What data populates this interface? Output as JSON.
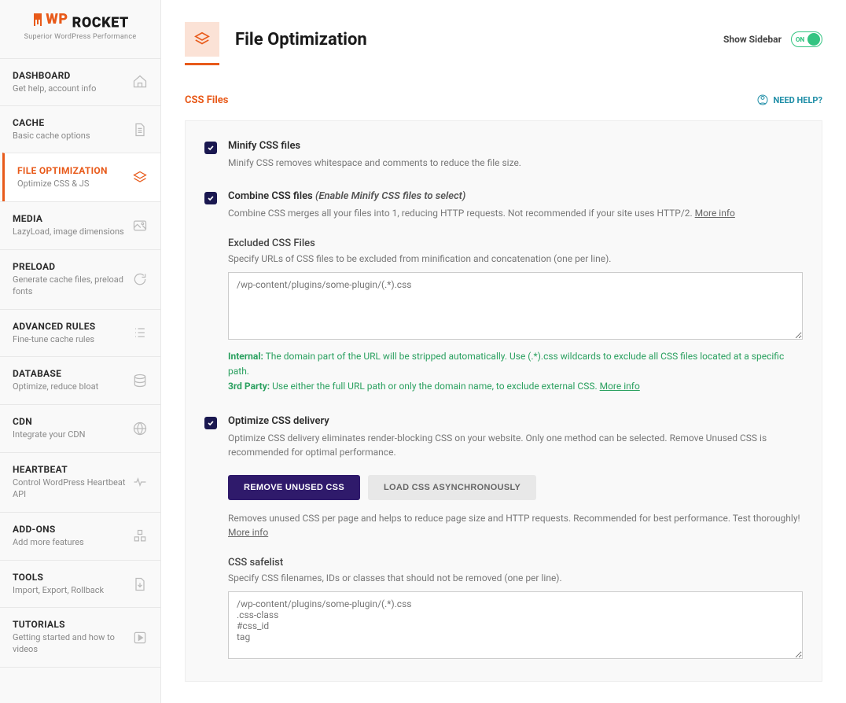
{
  "brand": {
    "name": "WP ROCKET",
    "tagline": "Superior WordPress Performance"
  },
  "nav": [
    {
      "title": "DASHBOARD",
      "sub": "Get help, account info"
    },
    {
      "title": "CACHE",
      "sub": "Basic cache options"
    },
    {
      "title": "FILE OPTIMIZATION",
      "sub": "Optimize CSS & JS"
    },
    {
      "title": "MEDIA",
      "sub": "LazyLoad, image dimensions"
    },
    {
      "title": "PRELOAD",
      "sub": "Generate cache files, preload fonts"
    },
    {
      "title": "ADVANCED RULES",
      "sub": "Fine-tune cache rules"
    },
    {
      "title": "DATABASE",
      "sub": "Optimize, reduce bloat"
    },
    {
      "title": "CDN",
      "sub": "Integrate your CDN"
    },
    {
      "title": "HEARTBEAT",
      "sub": "Control WordPress Heartbeat API"
    },
    {
      "title": "ADD-ONS",
      "sub": "Add more features"
    },
    {
      "title": "TOOLS",
      "sub": "Import, Export, Rollback"
    },
    {
      "title": "TUTORIALS",
      "sub": "Getting started and how to videos"
    }
  ],
  "header": {
    "title": "File Optimization",
    "show_sidebar": "Show Sidebar",
    "toggle_text": "ON"
  },
  "section": {
    "title": "CSS Files",
    "need_help": "NEED HELP?"
  },
  "options": {
    "minify": {
      "title": "Minify CSS files",
      "desc": "Minify CSS removes whitespace and comments to reduce the file size."
    },
    "combine": {
      "title": "Combine CSS files",
      "hint": "(Enable Minify CSS files to select)",
      "desc": "Combine CSS merges all your files into 1, reducing HTTP requests. Not recommended if your site uses HTTP/2.",
      "more": "More info",
      "excluded_label": "Excluded CSS Files",
      "excluded_desc": "Specify URLs of CSS files to be excluded from minification and concatenation (one per line).",
      "excluded_placeholder": "/wp-content/plugins/some-plugin/(.*).css",
      "helper_internal_label": "Internal:",
      "helper_internal": " The domain part of the URL will be stripped automatically. Use (.*).css wildcards to exclude all CSS files located at a specific path.",
      "helper_3rd_label": "3rd Party:",
      "helper_3rd": " Use either the full URL path or only the domain name, to exclude external CSS.",
      "helper_more": "More info"
    },
    "optimize": {
      "title": "Optimize CSS delivery",
      "desc": "Optimize CSS delivery eliminates render-blocking CSS on your website. Only one method can be selected. Remove Unused CSS is recommended for optimal performance.",
      "btn_remove": "REMOVE UNUSED CSS",
      "btn_async": "LOAD CSS ASYNCHRONOUSLY",
      "remove_desc": "Removes unused CSS per page and helps to reduce page size and HTTP requests. Recommended for best performance. Test thoroughly!",
      "more": "More info",
      "safelist_label": "CSS safelist",
      "safelist_desc": "Specify CSS filenames, IDs or classes that should not be removed (one per line).",
      "safelist_placeholder": "/wp-content/plugins/some-plugin/(.*).css\n.css-class\n#css_id\ntag"
    }
  }
}
